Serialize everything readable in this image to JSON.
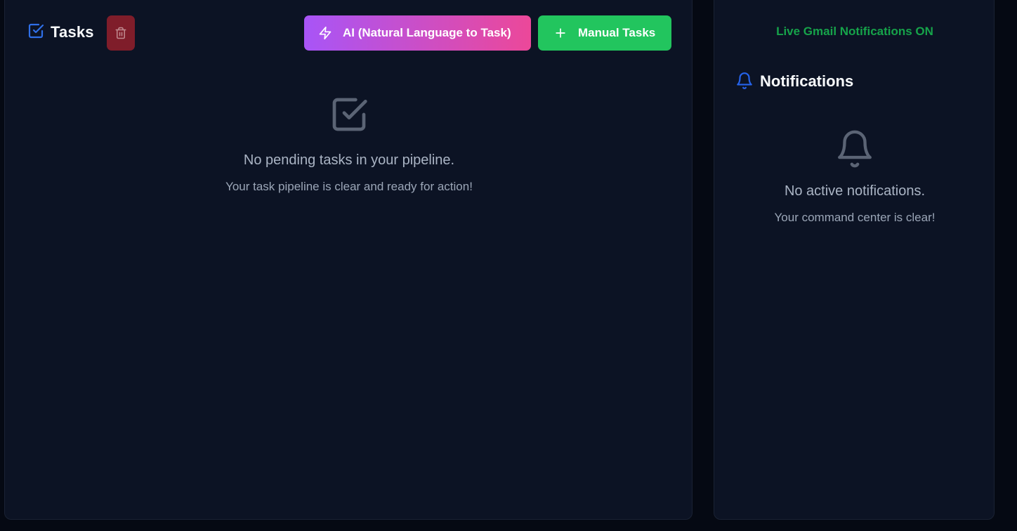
{
  "tasks": {
    "title": "Tasks",
    "ai_button_label": "AI (Natural Language to Task)",
    "manual_button_label": "Manual Tasks",
    "empty_title": "No pending tasks in your pipeline.",
    "empty_subtitle": "Your task pipeline is clear and ready for action!"
  },
  "notifications": {
    "live_status": "Live Gmail Notifications ON",
    "title": "Notifications",
    "empty_title": "No active notifications.",
    "empty_subtitle": "Your command center is clear!"
  },
  "icons": {
    "tasks_header": "check-square-icon",
    "delete": "trash-icon",
    "ai": "lightning-icon",
    "manual": "plus-icon",
    "tasks_empty": "check-square-icon",
    "notifications_header": "bell-icon",
    "notifications_empty": "bell-icon"
  },
  "colors": {
    "background": "#050913",
    "panel": "#0c1324",
    "accent_blue": "#2563eb",
    "delete_red": "#7f1d2a",
    "ai_gradient_start": "#a855f7",
    "ai_gradient_end": "#ec4899",
    "manual_green": "#22c55e",
    "live_green": "#16a34a"
  }
}
